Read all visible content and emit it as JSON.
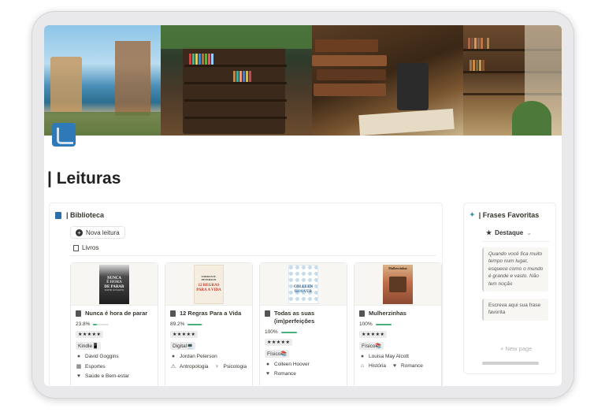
{
  "page": {
    "title": "| Leituras"
  },
  "library": {
    "title": "| Biblioteca",
    "new_button": "Nova leitura",
    "view_tab": "Livros",
    "books": [
      {
        "cover_text_top": "NUNCA",
        "cover_text_mid": "É HORA",
        "cover_text_bottom": "DE PARAR",
        "cover_author": "DAVID GOGGINS",
        "title": "Nunca é hora de parar",
        "progress_label": "23.8%",
        "progress": 0.238,
        "rating": "★★★★★",
        "format": "Kindle📱",
        "author": "David Goggins",
        "categories": [
          "Esportes",
          "Saúde e Bem-estar"
        ]
      },
      {
        "cover_text_top": "JORDAN B. PETERSON",
        "cover_text_mid": "12 REGRAS PARA A VIDA",
        "cover_text_bottom": "",
        "cover_author": "",
        "title": "12 Regras Para a Vida",
        "progress_label": "89.2%",
        "progress": 0.892,
        "rating": "★★★★★",
        "format": "Digital💻",
        "author": "Jordan Peterson",
        "categories": [
          "Antropologia",
          "Psicologia"
        ]
      },
      {
        "cover_text_top": "COLLEEN",
        "cover_text_mid": "HOOVER",
        "cover_text_bottom": "",
        "cover_author": "",
        "title": "Todas as suas (im)perfeições",
        "progress_label": "100%",
        "progress": 1.0,
        "rating": "★★★★★",
        "format": "Físico📚",
        "author": "Colleen Hoover",
        "categories": [
          "Romance"
        ]
      },
      {
        "cover_text_top": "Mulherzinhas",
        "cover_text_mid": "",
        "cover_text_bottom": "",
        "cover_author": "",
        "title": "Mulherzinhas",
        "progress_label": "100%",
        "progress": 1.0,
        "rating": "★★★★★",
        "format": "Físico📚",
        "author": "Louisa May Alcott",
        "categories": [
          "História",
          "Romance"
        ]
      }
    ]
  },
  "quotes": {
    "title": "| Frases Favoritas",
    "filter": "Destaque",
    "items": [
      "Quando você fica muito tempo num lugar, esquece como o mundo é grande e vasto. Não tem noção",
      "Escreva aqui sua frase favorita"
    ],
    "new_page": "+ New page"
  },
  "colors": {
    "accent": "#2e7ab8",
    "progress": "#4caf7c"
  }
}
